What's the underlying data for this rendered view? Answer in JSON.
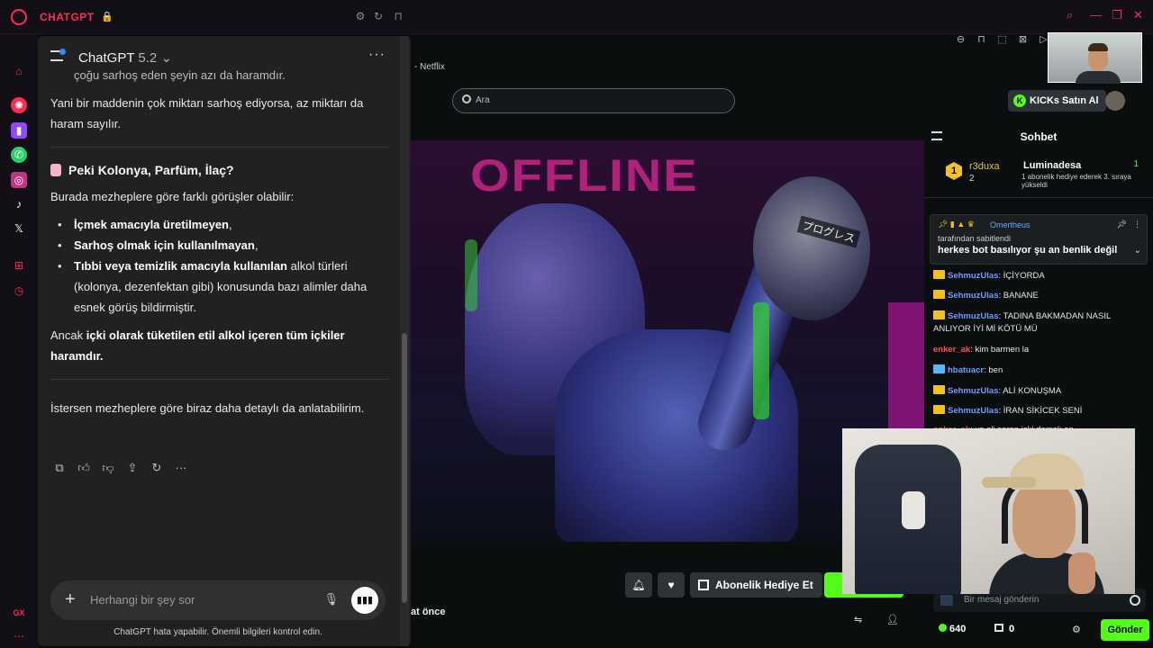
{
  "browser": {
    "brand": "CHATGPT",
    "sidebar_icons": [
      "home-icon",
      "chatgpt-icon",
      "twitch-icon",
      "whatsapp-icon",
      "instagram-icon",
      "tiktok-icon",
      "x-icon",
      "extensions-icon",
      "history-icon"
    ],
    "accent_color": "#ff2a4d",
    "gx_label": "GX"
  },
  "chatgpt": {
    "title": "ChatGPT",
    "version": "5.2",
    "cut_text": "çoğu sarhoş eden şeyin azı da haramdır.",
    "para1": "Yani bir maddenin çok miktarı sarhoş ediyorsa, az miktarı da haram sayılır.",
    "heading": "Peki Kolonya, Parfüm, İlaç?",
    "intro": "Burada mezheplere göre farklı görüşler olabilir:",
    "bullets": [
      {
        "bold": "İçmek amacıyla üretilmeyen",
        "rest": ","
      },
      {
        "bold": "Sarhoş olmak için kullanılmayan",
        "rest": ","
      },
      {
        "bold": "Tıbbi veya temizlik amacıyla kullanılan",
        "rest": " alkol türleri (kolonya, dezenfektan gibi) konusunda bazı alimler daha esnek görüş bildirmiştir."
      }
    ],
    "conclusion_pre": "Ancak ",
    "conclusion_bold": "içki olarak tüketilen etil alkol içeren tüm içkiler haramdır.",
    "offer": "İstersen mezheplere göre biraz daha detaylı da anlatabilirim.",
    "composer_placeholder": "Herhangi bir şey sor",
    "disclaimer": "ChatGPT hata yapabilir. Önemli bilgileri kontrol edin."
  },
  "kick": {
    "tab_hint": "- Netflix",
    "search_placeholder": "Ara",
    "buy_kicks": "KICKs Satın Al",
    "offline_text": "OFFLINE",
    "overlay_text": "プログレス",
    "gift_sub": "Abonelik Hediye Et",
    "time_ago": "at önce",
    "chat": {
      "title": "Sohbet",
      "leader_rank": "1",
      "leader_name": "r3duxa",
      "leader_count": "2",
      "gifter_name": "Luminadesa",
      "gifter_count": "1",
      "gifter_note": "1 abonelik hediye ederek 3. sıraya yükseldi",
      "pinned_user": "Omertheus",
      "pinned_by": "tarafından sabitlendi",
      "pinned_message": "herkes bot basılıyor şu an benlik değil",
      "messages": [
        {
          "user": "SehmuzUlas",
          "text": ": İÇİYORDA"
        },
        {
          "user": "SehmuzUlas",
          "text": ": BANANE"
        },
        {
          "user": "SehmuzUlas",
          "text": ": TADINA BAKMADAN NASIL ANLIYOR İYİ Mİ KÖTÜ MÜ"
        },
        {
          "user": "enker_ak",
          "text": ": kim barmen la"
        },
        {
          "user": "hbatuacr",
          "text": ": ben"
        },
        {
          "user": "SehmuzUlas",
          "text": ": ALİ KONUŞMA"
        },
        {
          "user": "SehmuzUlas",
          "text": ": İRAN SİKİCEK SENİ"
        },
        {
          "user": "enker_ak",
          "text": ": ya ali saran içki damak ep"
        }
      ],
      "input_placeholder": "Bir mesaj gönderin",
      "points": "640",
      "tokens": "0",
      "send": "Gönder"
    }
  }
}
